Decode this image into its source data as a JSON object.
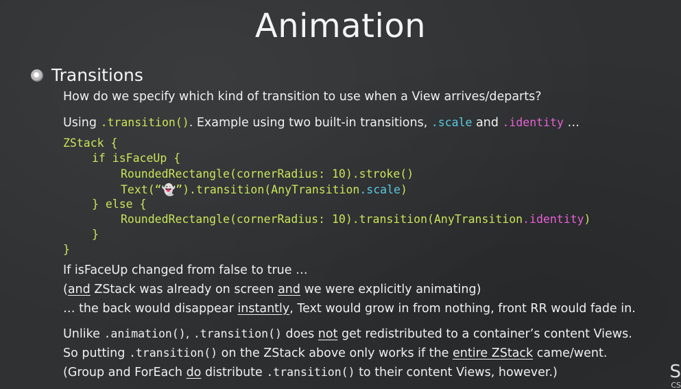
{
  "slide": {
    "title": "Animation",
    "bullet": "Transitions",
    "question": "How do we specify which kind of transition to use when a View arrives/departs?",
    "using": {
      "prefix": "Using ",
      "code": ".transition()",
      "mid": ".  Example using two built-in transitions, ",
      "scale": ".scale",
      "and": " and ",
      "identity": ".identity",
      "suffix": " …"
    },
    "code": {
      "l1": "ZStack {",
      "l2": "if isFaceUp {",
      "l3": "RoundedRectangle(cornerRadius: 10).stroke()",
      "l4a": "Text(“👻”).transition(AnyTransition",
      "l4b": ".scale",
      "l4c": ")",
      "l5": "} else {",
      "l6a": "RoundedRectangle(cornerRadius: 10).transition(AnyTransition",
      "l6b": ".identity",
      "l6c": ")",
      "l7": "}",
      "l8": "}"
    },
    "p1": {
      "a": "If isFaceUp changed from false to true …",
      "b1": "and",
      "b2": " ZStack was already on screen ",
      "b3": "and",
      "b4": " we were explicitly animating)",
      "c1": "… the back would disappear ",
      "c2": "instantly",
      "c3": ", Text would grow in from nothing, front RR would fade in."
    },
    "p2": {
      "a1": "Unlike ",
      "a2": ".animation()",
      "a3": ", ",
      "a4": ".transition()",
      "a5": " does ",
      "a6": "not",
      "a7": " get redistributed to a container’s content Views.",
      "b1": "So putting ",
      "b2": ".transition()",
      "b3": " on the ZStack above only works if the ",
      "b4": "entire ZStack",
      "b5": " came/went.",
      "c1": "(Group and ForEach ",
      "c2": "do",
      "c3": " distribute ",
      "c4": ".transition()",
      "c5": " to their content Views, however.)"
    },
    "corner_text": "CS"
  }
}
